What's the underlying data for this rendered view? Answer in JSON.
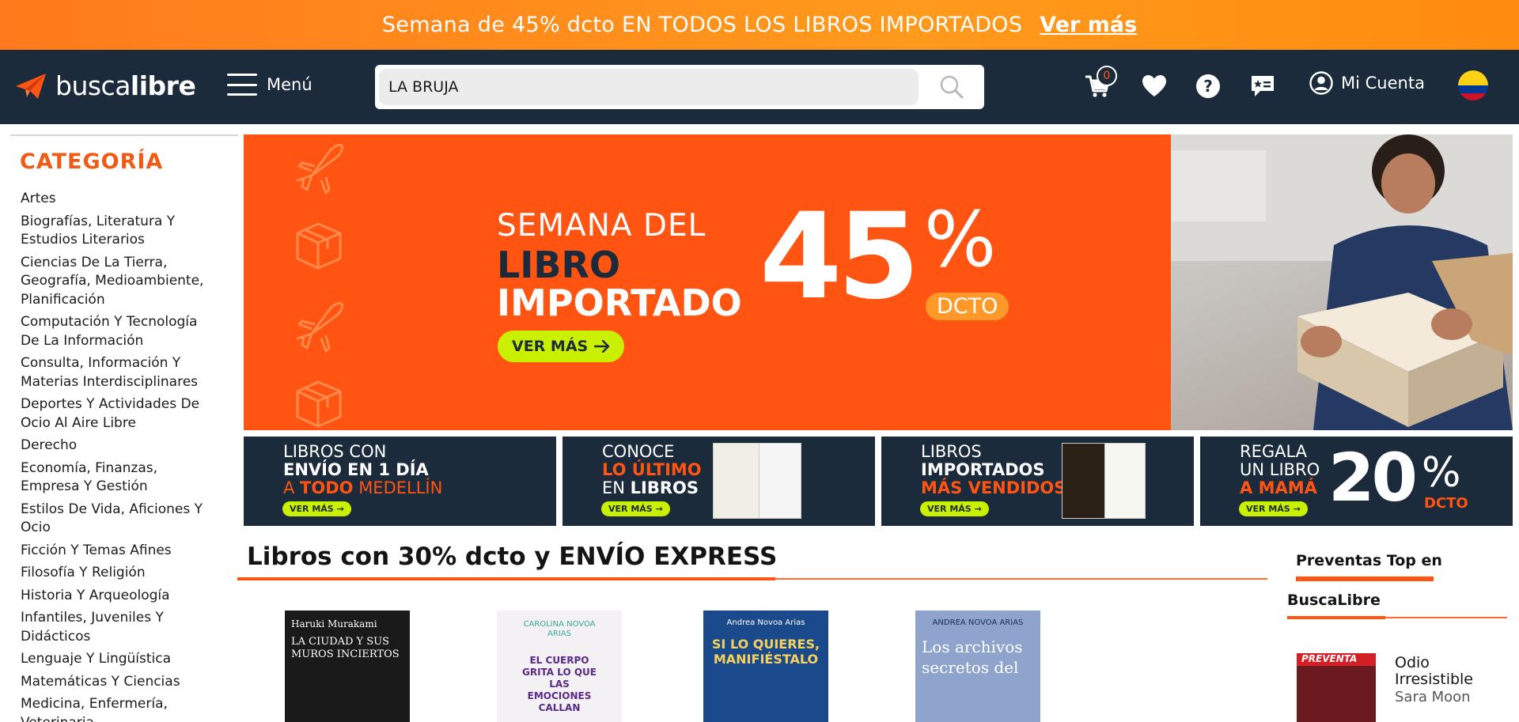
{
  "promo": {
    "text": "Semana de 45% dcto EN TODOS LOS LIBROS IMPORTADOS",
    "link": "Ver más"
  },
  "header": {
    "logo_light": "busca",
    "logo_bold": "libre",
    "menu_label": "Menú",
    "search_value": "LA BRUJA",
    "cart_count": "0",
    "account_label": "Mi Cuenta",
    "colors": {
      "bar": "#1c2b3c",
      "accent": "#ff5412"
    }
  },
  "sidebar": {
    "title": "CATEGORÍA",
    "items": [
      "Artes",
      "Biografías, Literatura Y Estudios Literarios",
      "Ciencias De La Tierra, Geografía, Medioambiente, Planificación",
      "Computación Y Tecnología De La Información",
      "Consulta, Información Y Materias Interdisciplinares",
      "Deportes Y Actividades De Ocio Al Aire Libre",
      "Derecho",
      "Economía, Finanzas, Empresa Y Gestión",
      "Estilos De Vida, Aficiones Y Ocio",
      "Ficción Y Temas Afines",
      "Filosofía Y Religión",
      "Historia Y Arqueología",
      "Infantiles, Juveniles Y Didácticos",
      "Lenguaje Y Lingüística",
      "Matemáticas Y Ciencias",
      "Medicina, Enfermería, Veterinaria"
    ]
  },
  "hero": {
    "line1": "SEMANA DEL",
    "line2": "LIBRO",
    "line3": "IMPORTADO",
    "number": "45",
    "percent": "%",
    "dcto": "DCTO",
    "cta": "VER MÁS"
  },
  "tiles": {
    "t1": {
      "l1": "LIBROS CON",
      "l2": "ENVÍO EN 1 DÍA",
      "l3a": "A ",
      "l3b": "TODO",
      "l3c": " MEDELLÍN",
      "cta": "VER MÁS"
    },
    "t2": {
      "l1": "CONOCE",
      "l2": "LO ÚLTIMO",
      "l3a": "EN ",
      "l3b": "LIBROS",
      "cta": "VER MÁS"
    },
    "t3": {
      "l1": "LIBROS",
      "l2": "IMPORTADOS",
      "l3": "MÁS VENDIDOS",
      "cta": "VER MÁS"
    },
    "t4": {
      "l1": "REGALA",
      "l2": "UN LIBRO",
      "l3": "A MAMÁ",
      "number": "20",
      "percent": "%",
      "dcto": "DCTO",
      "cta": "VER MÁS"
    }
  },
  "section": {
    "title": "Libros con 30% dcto y ENVÍO EXPRESS"
  },
  "books": [
    {
      "author": "Haruki Murakami",
      "title": "LA CIUDAD Y SUS MUROS INCIERTOS",
      "bg": "#1a1a1a"
    },
    {
      "author": "CAROLINA NOVOA ARIAS",
      "title": "EL CUERPO GRITA LO QUE LAS EMOCIONES CALLAN",
      "bg": "#f3f1f4"
    },
    {
      "author": "Andrea Novoa Arias",
      "title": "SI LO QUIERES, MANIFIÉSTALO",
      "bg": "#1b4a8c"
    },
    {
      "author": "ANDREA NOVOA ARIAS",
      "title": "Los archivos secretos del",
      "bg": "#8fa4cc"
    }
  ],
  "preventas": {
    "title1": "Preventas Top en",
    "title2": "BuscaLibre",
    "badge": "PREVENTA",
    "book_title": "Odio Irresistible",
    "book_author": "Sara Moon"
  }
}
